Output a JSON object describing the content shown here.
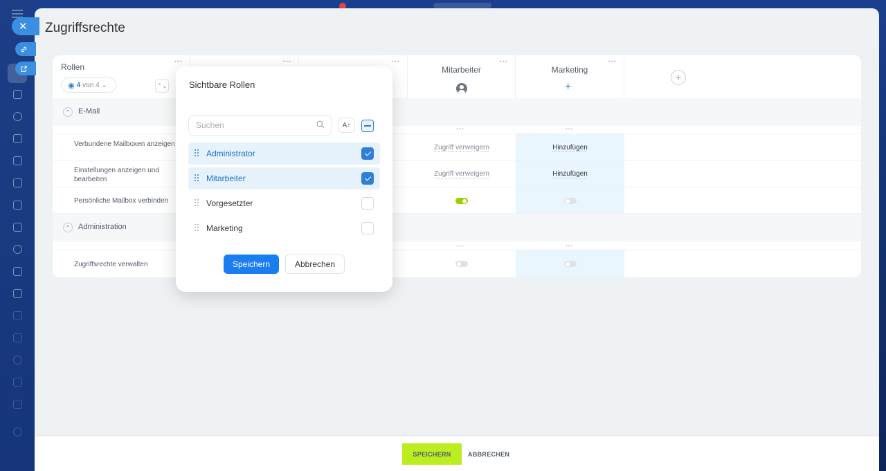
{
  "page": {
    "title": "Zugriffsrechte"
  },
  "table": {
    "roles_header": {
      "label": "Rollen",
      "visible_count": "4",
      "visible_of": "von 4"
    },
    "columns": [
      {
        "name": "Mitarbeiter",
        "icon": "user-avatar-icon"
      },
      {
        "name": "Marketing",
        "icon": "plus-icon"
      }
    ],
    "sections": [
      {
        "title": "E-Mail",
        "rows": [
          {
            "label": "Verbundene Mailboxen anzeigen",
            "mitarbeiter": "Zugriff verweigern",
            "marketing": "Hinzufügen"
          },
          {
            "label": "Einstellungen anzeigen und bearbeiten",
            "mitarbeiter": "Zugriff verweigern",
            "marketing": "Hinzufügen"
          },
          {
            "label": "Persönliche Mailbox verbinden",
            "mitarbeiter_toggle": true,
            "marketing_toggle": false
          }
        ]
      },
      {
        "title": "Administration",
        "rows": [
          {
            "label": "Zugriffsrechte verwalten",
            "mitarbeiter_toggle": false,
            "marketing_toggle": false
          }
        ]
      }
    ]
  },
  "popup": {
    "title": "Sichtbare Rollen",
    "search_placeholder": "Suchen",
    "sort_label": "A↑",
    "options": [
      {
        "label": "Administrator",
        "checked": true
      },
      {
        "label": "Mitarbeiter",
        "checked": true
      },
      {
        "label": "Vorgesetzter",
        "checked": false
      },
      {
        "label": "Marketing",
        "checked": false
      }
    ],
    "save_label": "Speichern",
    "cancel_label": "Abbrechen"
  },
  "footer": {
    "save_label": "SPEICHERN",
    "cancel_label": "ABBRECHEN"
  },
  "colors": {
    "accent": "#2f7ed8",
    "save_green": "#bbed21",
    "toggle_on": "#9dcf00",
    "marketing_column_bg": "#eaf6fd"
  }
}
